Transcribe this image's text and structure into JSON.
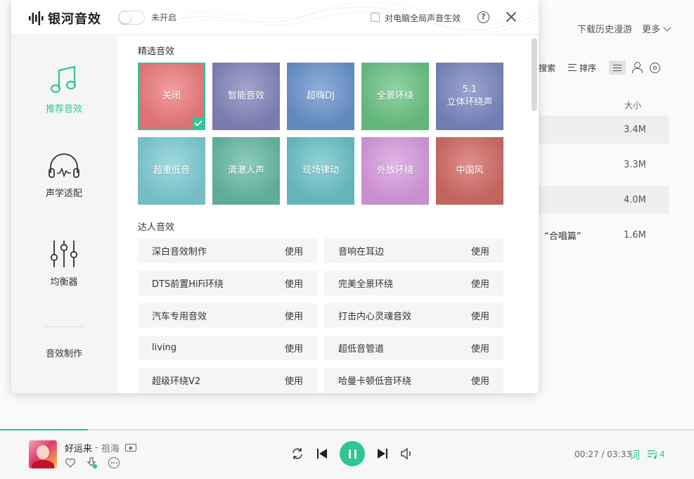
{
  "background": {
    "top_links": [
      "下载历史漫游",
      "更多"
    ],
    "toolbar": {
      "search": "搜索",
      "sort": "排序"
    },
    "size_header": "大小",
    "rows": [
      {
        "title": "",
        "size": "3.4M"
      },
      {
        "title": "",
        "size": "3.3M"
      },
      {
        "title": "",
        "size": "4.0M"
      },
      {
        "title": "“合唱篇”",
        "size": "1.6M"
      }
    ]
  },
  "player": {
    "song": "好运来",
    "separator": "-",
    "artist": "祖海",
    "time": "00:27 / 03:33",
    "lyric": "词",
    "queue_count": "4",
    "progress": 0.127,
    "accent": "#2fc594"
  },
  "modal": {
    "logo": "银河音效",
    "toggle_label": "未开启",
    "global_label": "对电脑全局声音生效",
    "help": "?",
    "sidebar": [
      {
        "label": "推荐音效",
        "icon": "music-note-icon",
        "active": true
      },
      {
        "label": "声学适配",
        "icon": "headphones-icon",
        "active": false
      },
      {
        "label": "均衡器",
        "icon": "equalizer-icon",
        "active": false
      }
    ],
    "sidebar_make": "音效制作",
    "featured_title": "精选音效",
    "featured": [
      {
        "label": "关闭",
        "color": "#ee7c7f",
        "selected": true
      },
      {
        "label": "智能音效",
        "color": "#8486bd"
      },
      {
        "label": "超嗨DJ",
        "color": "#6b94cd"
      },
      {
        "label": "全景环绕",
        "color": "#6cc486"
      },
      {
        "label": "5.1\n立体环绕声",
        "color": "#7c88c2"
      },
      {
        "label": "超重低音",
        "color": "#7fcdd5"
      },
      {
        "label": "清澈人声",
        "color": "#67bba5"
      },
      {
        "label": "现场律动",
        "color": "#6cc3c8"
      },
      {
        "label": "外放环绕",
        "color": "#d99be0"
      },
      {
        "label": "中国风",
        "color": "#d36b66"
      }
    ],
    "pro_title": "达人音效",
    "use_label": "使用",
    "pro": [
      "深白音效制作",
      "音响在耳边",
      "DTS前置HiFi环绕",
      "完美全景环绕",
      "汽车专用音效",
      "打击内心灵魂音效",
      "living",
      "超低音管道",
      "超级环绕V2",
      "哈曼卡顿低音环绕"
    ]
  }
}
